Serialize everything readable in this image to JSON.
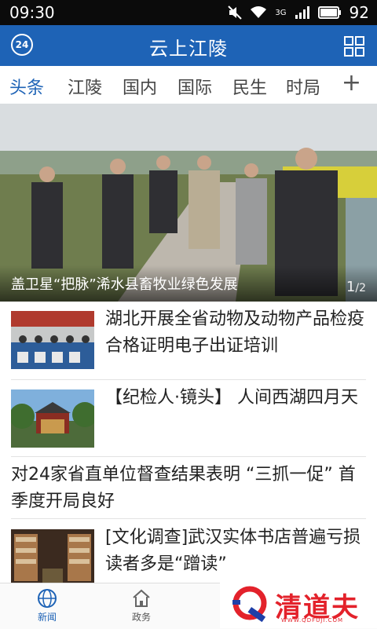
{
  "status": {
    "time": "09:30",
    "network": "3G",
    "battery": "92"
  },
  "app": {
    "title": "云上江陵",
    "badge": "24"
  },
  "tabs": [
    {
      "label": "头条",
      "active": true
    },
    {
      "label": "江陵"
    },
    {
      "label": "国内"
    },
    {
      "label": "国际"
    },
    {
      "label": "民生"
    },
    {
      "label": "时局"
    }
  ],
  "tab_more": "+",
  "hero": {
    "caption": "盖卫星“把脉”浠水县畜牧业绿色发展",
    "page_current": "1",
    "page_total": "2"
  },
  "news": [
    {
      "title": "湖北开展全省动物及动物产品检疫合格证明电子出证培训",
      "thumb": "meeting-photo"
    },
    {
      "title": "【纪检人·镜头】 人间西湖四月天",
      "thumb": "pavilion-photo"
    },
    {
      "title": "对24家省直单位督查结果表明 “三抓一促” 首季度开局良好"
    },
    {
      "title": "[文化调查]武汉实体书店普遍亏损 读者多是“蹭读”",
      "thumb": "bookstore-photo"
    }
  ],
  "bottom_nav": [
    {
      "label": "新闻",
      "icon": "globe-icon",
      "active": true
    },
    {
      "label": "政务",
      "icon": "home-icon"
    }
  ],
  "watermark": {
    "text": "清道夫",
    "sub": "WWW.QDFUJI.COM"
  },
  "colors": {
    "primary": "#1e63b6",
    "brand_red": "#e3222b"
  }
}
